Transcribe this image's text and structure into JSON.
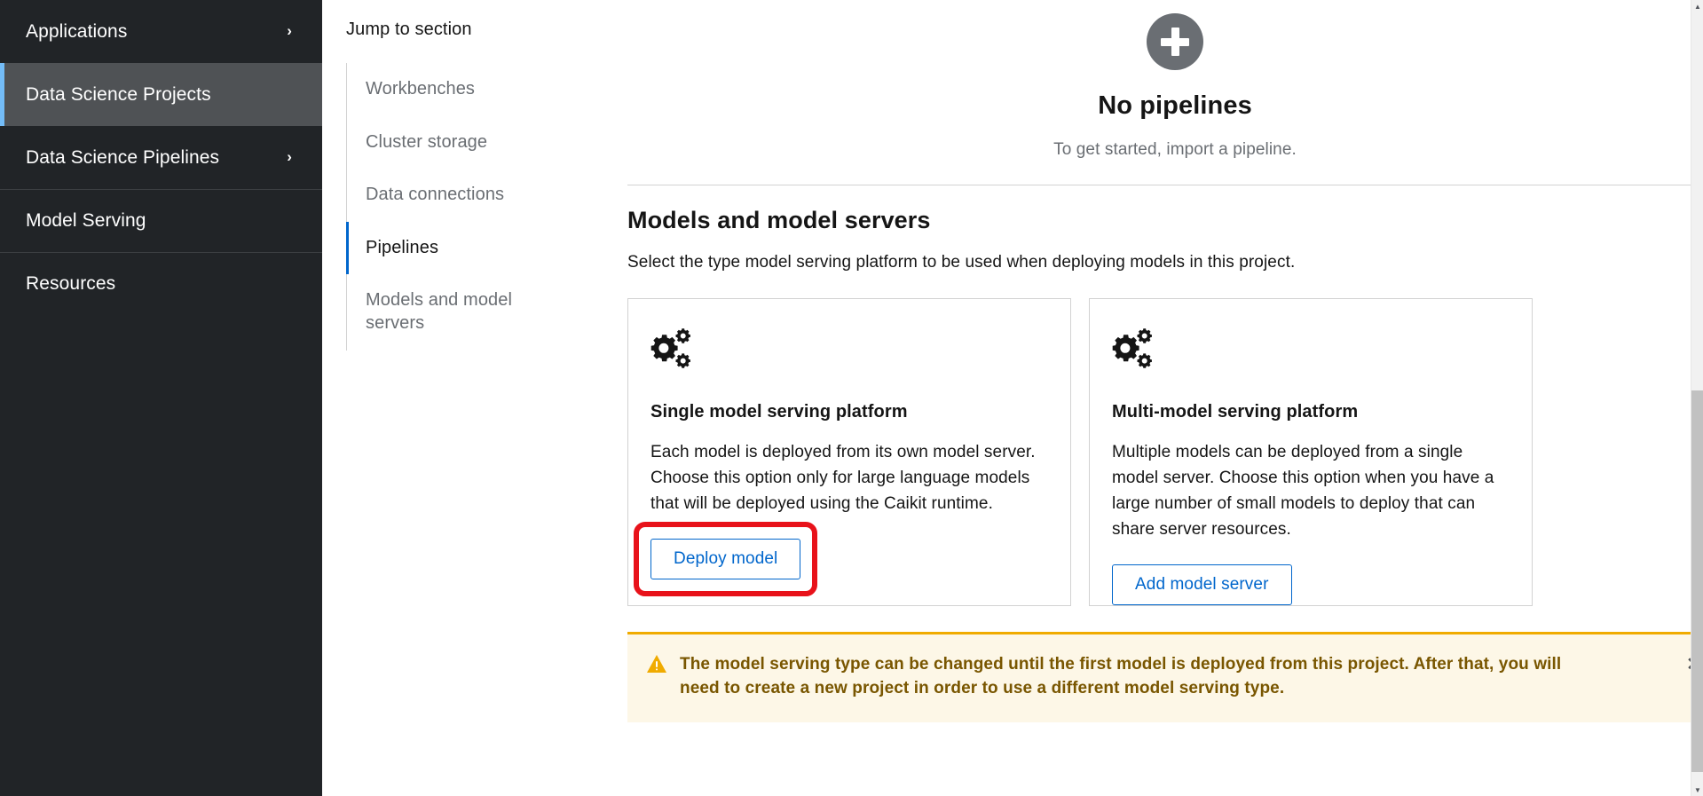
{
  "sidebar": {
    "items": [
      {
        "label": "Applications",
        "chevron": "›",
        "has_chevron": true,
        "active": false,
        "divider_above": false
      },
      {
        "label": "Data Science Projects",
        "has_chevron": false,
        "active": true,
        "divider_above": false
      },
      {
        "label": "Data Science Pipelines",
        "chevron": "›",
        "has_chevron": true,
        "active": false,
        "divider_above": false
      },
      {
        "label": "Model Serving",
        "has_chevron": false,
        "active": false,
        "divider_above": true
      },
      {
        "label": "Resources",
        "has_chevron": false,
        "active": false,
        "divider_above": true
      }
    ],
    "background_color": "#212427",
    "active_background_color": "#4f5255",
    "active_accent_color": "#73bcf7"
  },
  "jump_to_section": {
    "title": "Jump to section",
    "links": [
      {
        "label": "Workbenches",
        "current": false
      },
      {
        "label": "Cluster storage",
        "current": false
      },
      {
        "label": "Data connections",
        "current": false
      },
      {
        "label": "Pipelines",
        "current": true
      },
      {
        "label": "Models and model servers",
        "current": false
      }
    ],
    "current_accent_color": "#0066cc"
  },
  "empty_state": {
    "icon": "plus-circle-icon",
    "title": "No pipelines",
    "body": "To get started, import a pipeline."
  },
  "models_section": {
    "title": "Models and model servers",
    "description": "Select the type model serving platform to be used when deploying models in this project.",
    "cards": [
      {
        "icon": "gears-icon",
        "title": "Single model serving platform",
        "description": "Each model is deployed from its own model server. Choose this option only for large language models that will be deployed using the Caikit runtime.",
        "button_label": "Deploy model",
        "highlighted": true,
        "highlight_color": "#e8121a"
      },
      {
        "icon": "gears-icon",
        "title": "Multi-model serving platform",
        "description": "Multiple models can be deployed from a single model server. Choose this option when you have a large number of small models to deploy that can share server resources.",
        "button_label": "Add model server",
        "highlighted": false
      }
    ],
    "button_color": "#0066cc"
  },
  "alert": {
    "icon": "warning-triangle-icon",
    "text": "The model serving type can be changed until the first model is deployed from this project. After that, you will need to create a new project in order to use a different model serving type.",
    "close_label": "✕",
    "accent_color": "#f0ab00",
    "background_color": "#fdf7e7",
    "text_color": "#795600"
  },
  "scrollbar": {
    "up_arrow": "▲",
    "down_arrow": "▼"
  }
}
